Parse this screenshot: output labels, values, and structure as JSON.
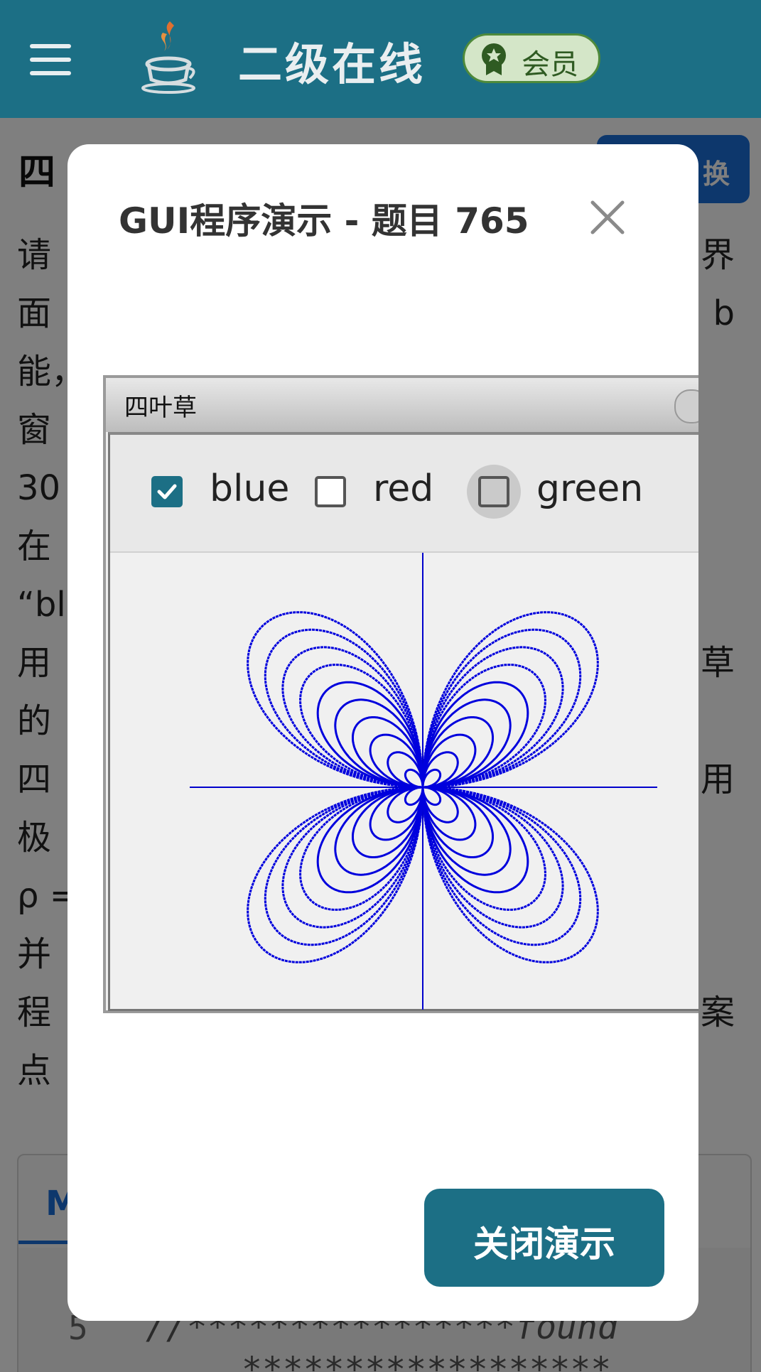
{
  "header": {
    "app_title": "二级在线",
    "vip_label": "会员"
  },
  "content": {
    "title_visible": "四",
    "switch_visible": "换",
    "lines": [
      {
        "left": "请",
        "right": "界"
      },
      {
        "left": "面",
        "right": "b"
      },
      {
        "left": "能，",
        "right": ""
      },
      {
        "left": "窗",
        "right": ""
      },
      {
        "left": "30",
        "right": ""
      },
      {
        "left": "在",
        "right": ""
      },
      {
        "left": "“bl",
        "right": ""
      },
      {
        "left": "用",
        "right": "草"
      },
      {
        "left": "的",
        "right": ""
      },
      {
        "left": "四",
        "right": "用"
      },
      {
        "left": "极",
        "right": ""
      },
      {
        "left": "ρ =",
        "right": ""
      },
      {
        "left": "并",
        "right": ""
      },
      {
        "left": "程",
        "right": "案"
      },
      {
        "left": "点",
        "right": ""
      }
    ],
    "code_tab": "M",
    "line_number": "5",
    "code_line": "//****************found",
    "code_line2": "******************"
  },
  "modal": {
    "title": "GUI程序演示 - 题目 765",
    "close_button_label": "关闭演示"
  },
  "java_window": {
    "title": "四叶草",
    "checkboxes": [
      {
        "label": "blue",
        "checked": true
      },
      {
        "label": "red",
        "checked": false
      },
      {
        "label": "green",
        "checked": false
      }
    ],
    "curve_color": "#0000dd",
    "axis_color": "#0000cc"
  },
  "colors": {
    "header_bg": "#1c6f85",
    "primary_button": "#1c6f85",
    "link_blue": "#1a6fd8"
  }
}
